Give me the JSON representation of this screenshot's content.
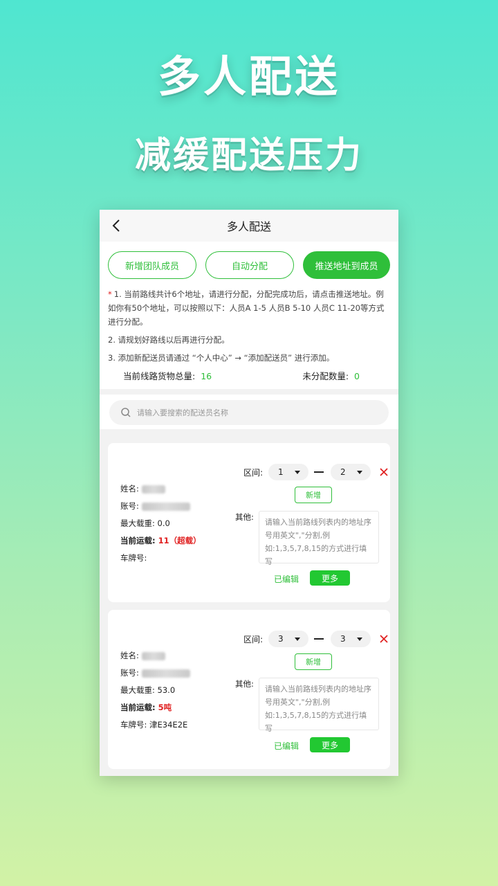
{
  "hero": {
    "title": "多人配送",
    "subtitle": "减缓配送压力"
  },
  "nav": {
    "title": "多人配送",
    "back_icon": "chevron-left-icon"
  },
  "buttons": {
    "add_member": "新增团队成员",
    "auto_assign": "自动分配",
    "push_address": "推送地址到成员"
  },
  "notes": {
    "star": "*",
    "n1": "1. 当前路线共计6个地址，请进行分配，分配完成功后，请点击推送地址。例如你有50个地址，可以按照以下：人员A 1-5 人员B 5-10 人员C 11-20等方式进行分配。",
    "n2": "2. 请规划好路线以后再进行分配。",
    "n3": "3. 添加新配送员请通过 “个人中心” → “添加配送员” 进行添加。"
  },
  "totals": {
    "goods_label": "当前线路货物总量:",
    "goods_value": "16",
    "unassigned_label": "未分配数量:",
    "unassigned_value": "0"
  },
  "search": {
    "placeholder": "请输入要搜索的配送员名称"
  },
  "labels": {
    "name": "姓名:",
    "account": "账号:",
    "max_load": "最大载重:",
    "current_load": "当前运载:",
    "plate": "车牌号:",
    "range": "区间:",
    "add": "新增",
    "other": "其他:",
    "other_placeholder": "请输入当前路线列表内的地址序号用英文\",\"分割,例如:1,3,5,7,8,15的方式进行填写",
    "edited": "已编辑",
    "more": "更多"
  },
  "couriers": [
    {
      "max_load": "0.0",
      "current_load": "11（超载）",
      "plate": "",
      "range_from": "1",
      "range_to": "2"
    },
    {
      "max_load": "53.0",
      "current_load": "5吨",
      "plate": "津E34E2E",
      "range_from": "3",
      "range_to": "3"
    }
  ],
  "colors": {
    "accent": "#2fbf3a",
    "warning": "#e02020"
  }
}
